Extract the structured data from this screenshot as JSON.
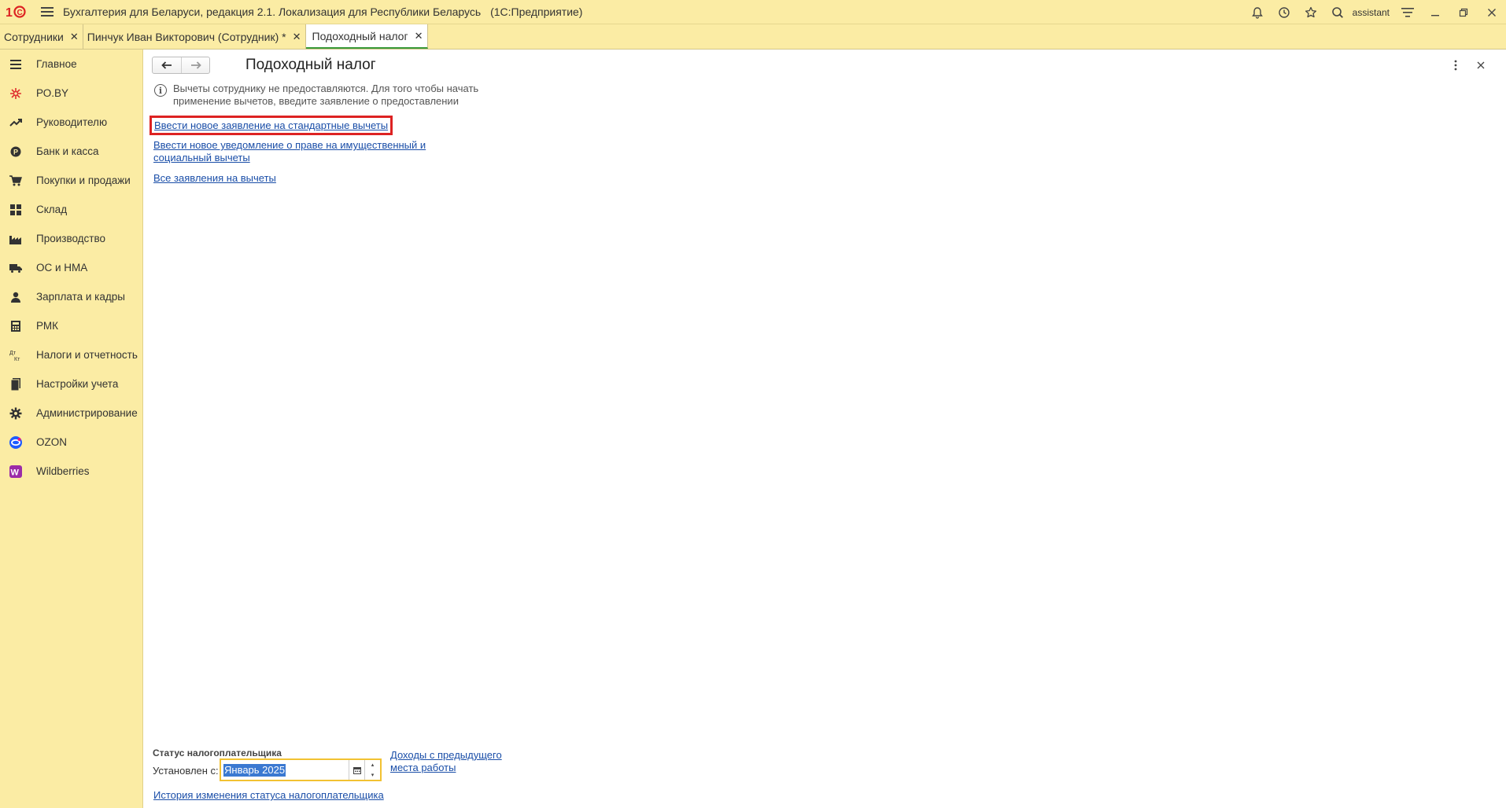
{
  "app": {
    "title": "Бухгалтерия для Беларуси, редакция 2.1. Локализация для Республики Беларусь",
    "platform": "(1С:Предприятие)",
    "user": "assistant"
  },
  "tabs": [
    {
      "label": "Сотрудники"
    },
    {
      "label": "Пинчук Иван Викторович (Сотрудник) *"
    },
    {
      "label": "Подоходный налог"
    }
  ],
  "sidebar": {
    "items": [
      {
        "label": "Главное",
        "icon": "menu-icon"
      },
      {
        "label": "РО.BY",
        "icon": "ro-by-icon"
      },
      {
        "label": "Руководителю",
        "icon": "trend-icon"
      },
      {
        "label": "Банк и касса",
        "icon": "coin-icon"
      },
      {
        "label": "Покупки и продажи",
        "icon": "cart-icon"
      },
      {
        "label": "Склад",
        "icon": "warehouse-icon"
      },
      {
        "label": "Производство",
        "icon": "factory-icon"
      },
      {
        "label": "ОС и НМА",
        "icon": "truck-icon"
      },
      {
        "label": "Зарплата и кадры",
        "icon": "person-icon"
      },
      {
        "label": "РМК",
        "icon": "cash-register-icon"
      },
      {
        "label": "Налоги и отчетность",
        "icon": "tax-icon"
      },
      {
        "label": "Настройки учета",
        "icon": "settings-book-icon"
      },
      {
        "label": "Администрирование",
        "icon": "gear-icon"
      },
      {
        "label": "OZON",
        "icon": "ozon-icon"
      },
      {
        "label": "Wildberries",
        "icon": "wildberries-icon"
      }
    ]
  },
  "page": {
    "title": "Подоходный налог",
    "info": "Вычеты сотруднику не предоставляются. Для того чтобы начать применение вычетов, введите заявление о предоставлении",
    "link_new_standard": "Ввести новое заявление на стандартные вычеты",
    "link_new_property": "Ввести новое уведомление о праве на имущественный и социальный вычеты",
    "link_all": "Все заявления на вычеты",
    "status_caption": "Статус налогоплательщика",
    "set_from_label": "Установлен с:",
    "set_from_value": "Январь 2025",
    "link_prev_income": "Доходы с предыдущего места работы",
    "link_history": "История изменения статуса налогоплательщика"
  },
  "colors": {
    "panel_bg": "#fbeca4",
    "link": "#1a4ea8",
    "highlight_border": "#dd2222",
    "field_focus": "#f2c232",
    "active_tab_underline": "#3a9a3a"
  }
}
